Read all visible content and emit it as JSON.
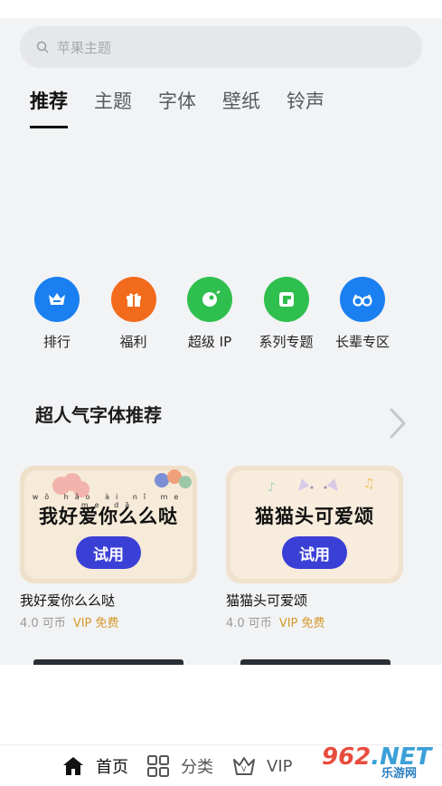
{
  "search": {
    "placeholder": "苹果主题"
  },
  "tabs": [
    {
      "label": "推荐",
      "active": true
    },
    {
      "label": "主题",
      "active": false
    },
    {
      "label": "字体",
      "active": false
    },
    {
      "label": "壁纸",
      "active": false
    },
    {
      "label": "铃声",
      "active": false
    }
  ],
  "categories": [
    {
      "label": "排行",
      "icon": "crown-icon",
      "color": "#1a7ff0"
    },
    {
      "label": "福利",
      "icon": "gift-icon",
      "color": "#f26a1b"
    },
    {
      "label": "超级 IP",
      "icon": "ip-icon",
      "color": "#2fbf4e"
    },
    {
      "label": "系列专题",
      "icon": "series-icon",
      "color": "#2fbf4e"
    },
    {
      "label": "长辈专区",
      "icon": "glasses-icon",
      "color": "#1a7ff0"
    }
  ],
  "section": {
    "title": "超人气字体推荐"
  },
  "cards": [
    {
      "preview": "我好爱你么么哒",
      "pinyin": "wǒ hǎo ài nǐ me me dā",
      "try_label": "试用",
      "name": "我好爱你么么哒",
      "price": "4.0 可币",
      "vip": "VIP 免费",
      "bg": "#f6ead8"
    },
    {
      "preview": "猫猫头可爱颂",
      "try_label": "试用",
      "name": "猫猫头可爱颂",
      "price": "4.0 可币",
      "vip": "VIP 免费",
      "bg": "#f8ecdc"
    }
  ],
  "bottom_nav": [
    {
      "label": "首页",
      "icon": "home-icon",
      "active": true
    },
    {
      "label": "分类",
      "icon": "grid-icon",
      "active": false
    },
    {
      "label": "VIP",
      "icon": "vip-crown-icon",
      "active": false
    }
  ],
  "watermark": {
    "big": "962",
    "suffix": ".NET",
    "small": "乐游网"
  }
}
